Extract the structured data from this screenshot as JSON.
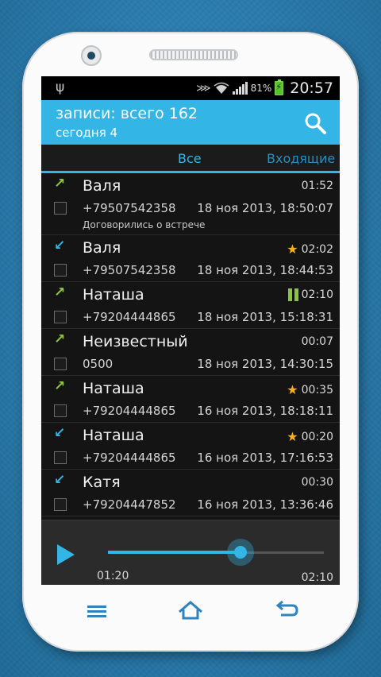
{
  "status": {
    "battery": "81%",
    "time": "20:57"
  },
  "header": {
    "title": "записи: всего 162",
    "subtitle": "сегодня 4"
  },
  "tabs": {
    "all": "Все",
    "incoming": "Входящие"
  },
  "records": [
    {
      "dir": "out",
      "name": "Валя",
      "duration": "01:52",
      "badge": "none",
      "phone": "+79507542358",
      "date": "18 ноя 2013, 18:50:07",
      "note": "Договорились о встрече"
    },
    {
      "dir": "in",
      "name": "Валя",
      "duration": "02:02",
      "badge": "star",
      "phone": "+79507542358",
      "date": "18 ноя 2013, 18:44:53",
      "note": ""
    },
    {
      "dir": "out",
      "name": "Наташа",
      "duration": "02:10",
      "badge": "pause",
      "phone": "+79204444865",
      "date": "18 ноя 2013, 15:18:31",
      "note": ""
    },
    {
      "dir": "out",
      "name": "Неизвестный",
      "duration": "00:07",
      "badge": "none",
      "phone": "0500",
      "date": "18 ноя 2013, 14:30:15",
      "note": ""
    },
    {
      "dir": "out",
      "name": "Наташа",
      "duration": "00:35",
      "badge": "star",
      "phone": "+79204444865",
      "date": "16 ноя 2013, 18:18:11",
      "note": ""
    },
    {
      "dir": "in",
      "name": "Наташа",
      "duration": "00:20",
      "badge": "star",
      "phone": "+79204444865",
      "date": "16 ноя 2013, 17:16:53",
      "note": ""
    },
    {
      "dir": "in",
      "name": "Катя",
      "duration": "00:30",
      "badge": "none",
      "phone": "+79204447852",
      "date": "16 ноя 2013, 13:36:46",
      "note": ""
    }
  ],
  "player": {
    "current": "01:20",
    "total": "02:10",
    "progress": 0.615
  },
  "colors": {
    "accent": "#33b5e5",
    "outgoing": "#8bc540",
    "star": "#f5b21b"
  }
}
